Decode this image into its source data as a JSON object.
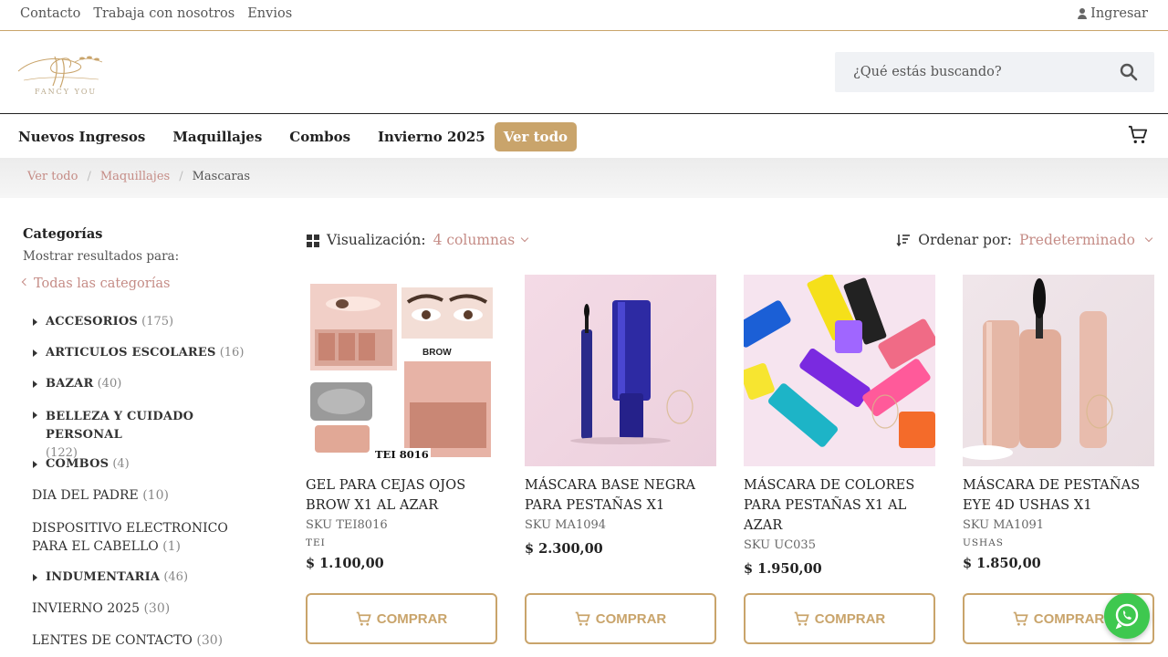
{
  "topbar": {
    "links": [
      "Contacto",
      "Trabaja con nosotros",
      "Envios"
    ],
    "login": "Ingresar"
  },
  "header": {
    "logo_text": "FANCY YOU",
    "search_placeholder": "¿Qué estás buscando?"
  },
  "nav": {
    "items": [
      "Nuevos Ingresos",
      "Maquillajes",
      "Combos",
      "Invierno 2025"
    ],
    "ver_todo": "Ver todo"
  },
  "breadcrumb": {
    "items": [
      "Ver todo",
      "Maquillajes"
    ],
    "separator": "/",
    "current": "Mascaras"
  },
  "sidebar": {
    "title": "Categorías",
    "subtitle": "Mostrar resultados para:",
    "all_categories": "Todas las categorías",
    "categories": [
      {
        "name": "ACCESORIOS",
        "count": "(175)"
      },
      {
        "name": "ARTICULOS ESCOLARES",
        "count": "(16)"
      },
      {
        "name": "BAZAR",
        "count": "(40)"
      },
      {
        "name": "BELLEZA Y CUIDADO PERSONAL",
        "count": "(122)"
      },
      {
        "name": "COMBOS",
        "count": "(4)"
      },
      {
        "name": "DIA DEL PADRE",
        "count": "(10)"
      },
      {
        "name": "DISPOSITIVO ELECTRONICO PARA EL CABELLO",
        "count": "(1)"
      },
      {
        "name": "INDUMENTARIA",
        "count": "(46)"
      },
      {
        "name": "INVIERNO 2025",
        "count": "(30)"
      },
      {
        "name": "LENTES DE CONTACTO",
        "count": "(30)"
      }
    ]
  },
  "toolbar": {
    "view_label": "Visualización:",
    "view_value": "4 columnas",
    "sort_label": "Ordenar por:",
    "sort_value": "Predeterminado"
  },
  "products": [
    {
      "name": "GEL PARA CEJAS OJOS BROW X1 AL AZAR",
      "sku": "SKU TEI8016",
      "brand": "TEI",
      "price": "$  1.100,00",
      "image_label": "TEI 8016",
      "button": "COMPRAR"
    },
    {
      "name": "MÁSCARA BASE NEGRA PARA PESTAÑAS X1",
      "sku": "SKU MA1094",
      "brand": "",
      "price": "$  2.300,00",
      "button": "COMPRAR"
    },
    {
      "name": "MÁSCARA DE COLORES PARA PESTAÑAS X1 AL AZAR",
      "sku": "SKU UC035",
      "brand": "",
      "price": "$  1.950,00",
      "button": "COMPRAR"
    },
    {
      "name": "MÁSCARA DE PESTAÑAS EYE 4D USHAS X1",
      "sku": "SKU MA1091",
      "brand": "USHAS",
      "price": "$  1.850,00",
      "button": "COMPRAR"
    }
  ],
  "colors": {
    "accent_gold": "#c9a46b",
    "link_rose": "#c58c86",
    "whatsapp_green": "#3ec84f"
  },
  "icons": [
    "user-icon",
    "search-icon",
    "cart-icon",
    "grid-icon",
    "sort-icon",
    "cart-buy-icon",
    "whatsapp-icon"
  ]
}
